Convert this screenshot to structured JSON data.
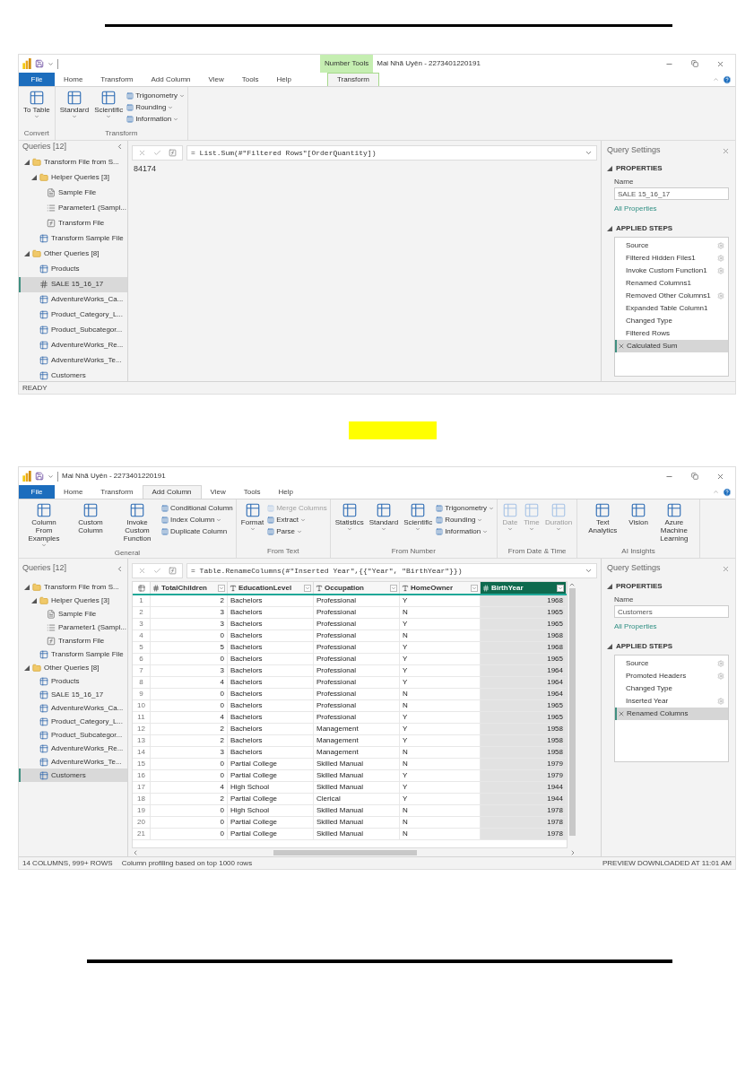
{
  "screenshots": [
    {
      "title": "Mai Nhã Uyên - 2273401220191",
      "contextual_group": "Number Tools",
      "tabs": [
        {
          "label": "File",
          "kind": "file",
          "selected": false
        },
        {
          "label": "Home",
          "kind": "normal",
          "selected": false
        },
        {
          "label": "Transform",
          "kind": "normal",
          "selected": false
        },
        {
          "label": "Add Column",
          "kind": "normal",
          "selected": false
        },
        {
          "label": "View",
          "kind": "normal",
          "selected": false
        },
        {
          "label": "Tools",
          "kind": "normal",
          "selected": false
        },
        {
          "label": "Help",
          "kind": "normal",
          "selected": false
        },
        {
          "label": "Transform",
          "kind": "contextual",
          "selected": true
        }
      ],
      "ribbon_groups": [
        {
          "label": "Convert",
          "items": [
            {
              "label": "To Table",
              "kind": "large",
              "dropdown": true
            }
          ]
        },
        {
          "label": "Transform",
          "items": [
            {
              "label": "Standard",
              "kind": "large",
              "dropdown": true
            },
            {
              "label": "Scientific",
              "kind": "large",
              "dropdown": true
            },
            {
              "label": "Trigonometry",
              "kind": "small",
              "dropdown": true
            },
            {
              "label": "Rounding",
              "kind": "small",
              "dropdown": true
            },
            {
              "label": "Information",
              "kind": "small",
              "dropdown": true
            }
          ]
        }
      ],
      "queries": {
        "title": "Queries [12]",
        "tree": [
          {
            "label": "Transform File from S...",
            "kind": "folder",
            "expanded": true,
            "selected": false,
            "children": [
              {
                "label": "Helper Queries [3]",
                "kind": "folder",
                "expanded": true,
                "selected": false,
                "children": [
                  {
                    "label": "Sample File",
                    "kind": "file",
                    "selected": false
                  },
                  {
                    "label": "Parameter1 (Sampl...",
                    "kind": "parameter",
                    "selected": false
                  },
                  {
                    "label": "Transform File",
                    "kind": "function",
                    "selected": false
                  }
                ]
              },
              {
                "label": "Transform Sample File",
                "kind": "table",
                "selected": false
              }
            ]
          },
          {
            "label": "Other Queries [8]",
            "kind": "folder",
            "expanded": true,
            "selected": false,
            "children": [
              {
                "label": "Products",
                "kind": "table",
                "selected": false
              },
              {
                "label": "SALE 15_16_17",
                "kind": "number",
                "selected": true
              },
              {
                "label": "AdventureWorks_Ca...",
                "kind": "table",
                "selected": false
              },
              {
                "label": "Product_Category_L...",
                "kind": "table",
                "selected": false
              },
              {
                "label": "Product_Subcategor...",
                "kind": "table",
                "selected": false
              },
              {
                "label": "AdventureWorks_Re...",
                "kind": "table",
                "selected": false
              },
              {
                "label": "AdventureWorks_Te...",
                "kind": "table",
                "selected": false
              },
              {
                "label": "Customers",
                "kind": "table",
                "selected": false
              }
            ]
          }
        ]
      },
      "formula": "= List.Sum(#\"Filtered Rows\"[OrderQuantity])",
      "content": {
        "kind": "value",
        "text": "84174"
      },
      "settings": {
        "title": "Query Settings",
        "properties_heading": "PROPERTIES",
        "name_label": "Name",
        "name_value": "SALE 15_16_17",
        "all_properties": "All Properties",
        "steps_heading": "APPLIED STEPS",
        "steps": [
          {
            "label": "Source",
            "has_settings": true,
            "selected": false
          },
          {
            "label": "Filtered Hidden Files1",
            "has_settings": true,
            "selected": false
          },
          {
            "label": "Invoke Custom Function1",
            "has_settings": true,
            "selected": false
          },
          {
            "label": "Renamed Columns1",
            "has_settings": false,
            "selected": false
          },
          {
            "label": "Removed Other Columns1",
            "has_settings": true,
            "selected": false
          },
          {
            "label": "Expanded Table Column1",
            "has_settings": false,
            "selected": false
          },
          {
            "label": "Changed Type",
            "has_settings": false,
            "selected": false
          },
          {
            "label": "Filtered Rows",
            "has_settings": false,
            "selected": false
          },
          {
            "label": "Calculated Sum",
            "has_settings": false,
            "selected": true
          }
        ]
      },
      "status": {
        "left": [
          "READY"
        ]
      }
    },
    {
      "title": "Mai Nhã Uyên - 2273401220191",
      "tabs": [
        {
          "label": "File",
          "kind": "file",
          "selected": false
        },
        {
          "label": "Home",
          "kind": "normal",
          "selected": false
        },
        {
          "label": "Transform",
          "kind": "normal",
          "selected": false
        },
        {
          "label": "Add Column",
          "kind": "normal",
          "selected": true
        },
        {
          "label": "View",
          "kind": "normal",
          "selected": false
        },
        {
          "label": "Tools",
          "kind": "normal",
          "selected": false
        },
        {
          "label": "Help",
          "kind": "normal",
          "selected": false
        }
      ],
      "ribbon_groups": [
        {
          "label": "General",
          "items": [
            {
              "label": "Column From Examples",
              "kind": "large",
              "dropdown": true
            },
            {
              "label": "Custom Column",
              "kind": "large",
              "dropdown": false
            },
            {
              "label": "Invoke Custom Function",
              "kind": "large",
              "dropdown": false
            },
            {
              "label": "Conditional Column",
              "kind": "small",
              "dropdown": false
            },
            {
              "label": "Index Column",
              "kind": "small",
              "dropdown": true
            },
            {
              "label": "Duplicate Column",
              "kind": "small",
              "dropdown": false
            }
          ]
        },
        {
          "label": "From Text",
          "items": [
            {
              "label": "Format",
              "kind": "large",
              "dropdown": true,
              "disabled": false
            },
            {
              "label": "Merge Columns",
              "kind": "small",
              "dropdown": false,
              "disabled": true
            },
            {
              "label": "Extract",
              "kind": "small",
              "dropdown": true,
              "disabled": false
            },
            {
              "label": "Parse",
              "kind": "small",
              "dropdown": true,
              "disabled": false
            }
          ]
        },
        {
          "label": "From Number",
          "items": [
            {
              "label": "Statistics",
              "kind": "large",
              "dropdown": true
            },
            {
              "label": "Standard",
              "kind": "large",
              "dropdown": true
            },
            {
              "label": "Scientific",
              "kind": "large",
              "dropdown": true
            },
            {
              "label": "Trigonometry",
              "kind": "small",
              "dropdown": true
            },
            {
              "label": "Rounding",
              "kind": "small",
              "dropdown": true
            },
            {
              "label": "Information",
              "kind": "small",
              "dropdown": true
            }
          ]
        },
        {
          "label": "From Date & Time",
          "items": [
            {
              "label": "Date",
              "kind": "large",
              "dropdown": true,
              "disabled": true
            },
            {
              "label": "Time",
              "kind": "large",
              "dropdown": true,
              "disabled": true
            },
            {
              "label": "Duration",
              "kind": "large",
              "dropdown": true,
              "disabled": true
            }
          ]
        },
        {
          "label": "AI Insights",
          "items": [
            {
              "label": "Text Analytics",
              "kind": "large",
              "dropdown": false
            },
            {
              "label": "Vision",
              "kind": "large",
              "dropdown": false
            },
            {
              "label": "Azure Machine Learning",
              "kind": "large",
              "dropdown": false
            }
          ]
        }
      ],
      "queries": {
        "title": "Queries [12]",
        "tree": [
          {
            "label": "Transform File from S...",
            "kind": "folder",
            "expanded": true,
            "selected": false,
            "children": [
              {
                "label": "Helper Queries [3]",
                "kind": "folder",
                "expanded": true,
                "selected": false,
                "children": [
                  {
                    "label": "Sample File",
                    "kind": "file",
                    "selected": false
                  },
                  {
                    "label": "Parameter1 (Sampl...",
                    "kind": "parameter",
                    "selected": false
                  },
                  {
                    "label": "Transform File",
                    "kind": "function",
                    "selected": false
                  }
                ]
              },
              {
                "label": "Transform Sample File",
                "kind": "table",
                "selected": false
              }
            ]
          },
          {
            "label": "Other Queries [8]",
            "kind": "folder",
            "expanded": true,
            "selected": false,
            "children": [
              {
                "label": "Products",
                "kind": "table",
                "selected": false
              },
              {
                "label": "SALE 15_16_17",
                "kind": "table",
                "selected": false
              },
              {
                "label": "AdventureWorks_Ca...",
                "kind": "table",
                "selected": false
              },
              {
                "label": "Product_Category_L...",
                "kind": "table",
                "selected": false
              },
              {
                "label": "Product_Subcategor...",
                "kind": "table",
                "selected": false
              },
              {
                "label": "AdventureWorks_Re...",
                "kind": "table",
                "selected": false
              },
              {
                "label": "AdventureWorks_Te...",
                "kind": "table",
                "selected": false
              },
              {
                "label": "Customers",
                "kind": "table",
                "selected": true
              }
            ]
          }
        ]
      },
      "formula": "= Table.RenameColumns(#\"Inserted Year\",{{\"Year\", \"BirthYear\"}})",
      "content": {
        "kind": "table",
        "columns": [
          {
            "name": "TotalChildren",
            "kind": "number",
            "selected": false
          },
          {
            "name": "EducationLevel",
            "kind": "text",
            "selected": false
          },
          {
            "name": "Occupation",
            "kind": "text",
            "selected": false
          },
          {
            "name": "HomeOwner",
            "kind": "text",
            "selected": false
          },
          {
            "name": "BirthYear",
            "kind": "number",
            "selected": true
          }
        ],
        "rows": [
          {
            "number": "1",
            "cells": [
              "2",
              "Bachelors",
              "Professional",
              "Y",
              "1968"
            ]
          },
          {
            "number": "2",
            "cells": [
              "3",
              "Bachelors",
              "Professional",
              "N",
              "1965"
            ]
          },
          {
            "number": "3",
            "cells": [
              "3",
              "Bachelors",
              "Professional",
              "Y",
              "1965"
            ]
          },
          {
            "number": "4",
            "cells": [
              "0",
              "Bachelors",
              "Professional",
              "N",
              "1968"
            ]
          },
          {
            "number": "5",
            "cells": [
              "5",
              "Bachelors",
              "Professional",
              "Y",
              "1968"
            ]
          },
          {
            "number": "6",
            "cells": [
              "0",
              "Bachelors",
              "Professional",
              "Y",
              "1965"
            ]
          },
          {
            "number": "7",
            "cells": [
              "3",
              "Bachelors",
              "Professional",
              "Y",
              "1964"
            ]
          },
          {
            "number": "8",
            "cells": [
              "4",
              "Bachelors",
              "Professional",
              "Y",
              "1964"
            ]
          },
          {
            "number": "9",
            "cells": [
              "0",
              "Bachelors",
              "Professional",
              "N",
              "1964"
            ]
          },
          {
            "number": "10",
            "cells": [
              "0",
              "Bachelors",
              "Professional",
              "N",
              "1965"
            ]
          },
          {
            "number": "11",
            "cells": [
              "4",
              "Bachelors",
              "Professional",
              "Y",
              "1965"
            ]
          },
          {
            "number": "12",
            "cells": [
              "2",
              "Bachelors",
              "Management",
              "Y",
              "1958"
            ]
          },
          {
            "number": "13",
            "cells": [
              "2",
              "Bachelors",
              "Management",
              "Y",
              "1958"
            ]
          },
          {
            "number": "14",
            "cells": [
              "3",
              "Bachelors",
              "Management",
              "N",
              "1958"
            ]
          },
          {
            "number": "15",
            "cells": [
              "0",
              "Partial College",
              "Skilled Manual",
              "N",
              "1979"
            ]
          },
          {
            "number": "16",
            "cells": [
              "0",
              "Partial College",
              "Skilled Manual",
              "Y",
              "1979"
            ]
          },
          {
            "number": "17",
            "cells": [
              "4",
              "High School",
              "Skilled Manual",
              "Y",
              "1944"
            ]
          },
          {
            "number": "18",
            "cells": [
              "2",
              "Partial College",
              "Clerical",
              "Y",
              "1944"
            ]
          },
          {
            "number": "19",
            "cells": [
              "0",
              "High School",
              "Skilled Manual",
              "N",
              "1978"
            ]
          },
          {
            "number": "20",
            "cells": [
              "0",
              "Partial College",
              "Skilled Manual",
              "N",
              "1978"
            ]
          },
          {
            "number": "21",
            "cells": [
              "0",
              "Partial College",
              "Skilled Manual",
              "N",
              "1978"
            ]
          }
        ]
      },
      "settings": {
        "title": "Query Settings",
        "properties_heading": "PROPERTIES",
        "name_label": "Name",
        "name_value": "Customers",
        "all_properties": "All Properties",
        "steps_heading": "APPLIED STEPS",
        "steps": [
          {
            "label": "Source",
            "has_settings": true,
            "selected": false
          },
          {
            "label": "Promoted Headers",
            "has_settings": true,
            "selected": false
          },
          {
            "label": "Changed Type",
            "has_settings": false,
            "selected": false
          },
          {
            "label": "Inserted Year",
            "has_settings": true,
            "selected": false
          },
          {
            "label": "Renamed Columns",
            "has_settings": false,
            "selected": true
          }
        ]
      },
      "status": {
        "left": [
          "14 COLUMNS, 999+ ROWS",
          "Column profiling based on top 1000 rows"
        ],
        "right": "PREVIEW DOWNLOADED AT 11:01 AM"
      }
    }
  ]
}
